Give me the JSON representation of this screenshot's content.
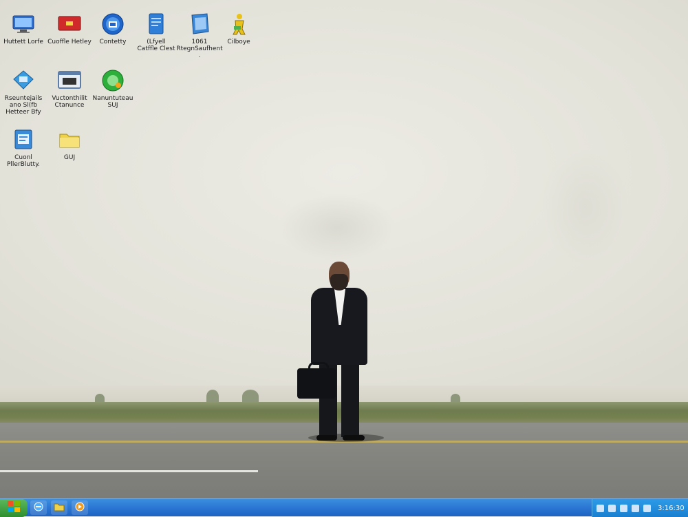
{
  "desktop": {
    "icons": [
      {
        "name": "desktop-icon-1",
        "label": "Huttett Lorfe",
        "icon": "monitor-icon",
        "color": "#2f6fcf"
      },
      {
        "name": "desktop-icon-2",
        "label": "Cuoffle Hetley",
        "icon": "red-card-icon",
        "color": "#d12a2a"
      },
      {
        "name": "desktop-icon-3",
        "label": "Contetty",
        "icon": "globe-icon",
        "color": "#1f64c9"
      },
      {
        "name": "desktop-icon-4",
        "label": "(Lfyell\nCatffle Clest",
        "icon": "blue-document-icon",
        "color": "#2f7fd8"
      },
      {
        "name": "desktop-icon-5",
        "label": "1061\nRtegnSaufhent .",
        "icon": "blue-book-icon",
        "color": "#3a86d6"
      },
      {
        "name": "desktop-icon-6",
        "label": "Cilboye",
        "icon": "yellow-figure-icon",
        "color": "#e8c21a"
      },
      {
        "name": "desktop-icon-7",
        "label": "Rseuntejails\nano  Sl(fb\nHetteer Bfy",
        "icon": "network-icon",
        "color": "#3b9be0"
      },
      {
        "name": "desktop-icon-8",
        "label": "Vuctonthilit\nCtanunce",
        "icon": "window-icon",
        "color": "#5d7ea8"
      },
      {
        "name": "desktop-icon-9",
        "label": "Nanuntuteau\nSUJ",
        "icon": "green-circle-icon",
        "color": "#2eae3a"
      },
      {
        "name": "desktop-icon-10",
        "label": "Cuonl\nPllerBlutty.",
        "icon": "file-icon",
        "color": "#3b8ad8"
      },
      {
        "name": "desktop-icon-11",
        "label": "GUJ",
        "icon": "folder-icon",
        "color": "#f0d24a"
      }
    ]
  },
  "taskbar": {
    "start_icon": "windows-logo-icon",
    "quick_launch": [
      "ie-icon",
      "folder-icon",
      "media-icon"
    ],
    "clock": "3:16:30",
    "colors": {
      "bar": "#2c79d4",
      "start": "#3a9d3a"
    }
  }
}
